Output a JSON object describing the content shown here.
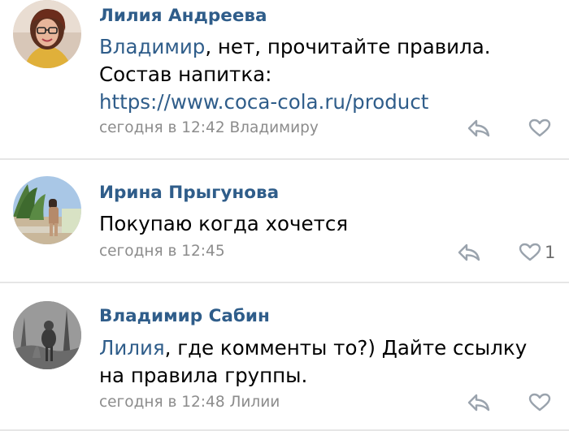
{
  "comments": [
    {
      "author": "Лилия Андреева",
      "mention": "Владимир",
      "text_after_mention": ", нет, прочитайте правила.",
      "line2": "Состав напитка:",
      "link": "https://www.coca-cola.ru/product",
      "meta": "сегодня в 12:42 Владимиру",
      "reply_icon": "reply-icon",
      "like_icon": "heart-icon"
    },
    {
      "author": "Ирина Прыгунова",
      "text": "Покупаю когда хочется",
      "meta": "сегодня в 12:45",
      "reply_icon": "reply-icon",
      "like_icon": "heart-icon",
      "like_count": "1"
    },
    {
      "author": "Владимир Сабин",
      "mention": "Лилия",
      "text_after_mention": ", где комменты то?) Дайте ссылку",
      "line2": "на правила группы.",
      "meta": "сегодня в 12:48 Лилии",
      "reply_icon": "reply-icon",
      "like_icon": "heart-icon"
    }
  ],
  "colors": {
    "author": "#2f5d8a",
    "link": "#2f5d8a",
    "meta": "#8c8c8c",
    "icon": "#9aa3ad",
    "divider": "#e6e6e6"
  }
}
